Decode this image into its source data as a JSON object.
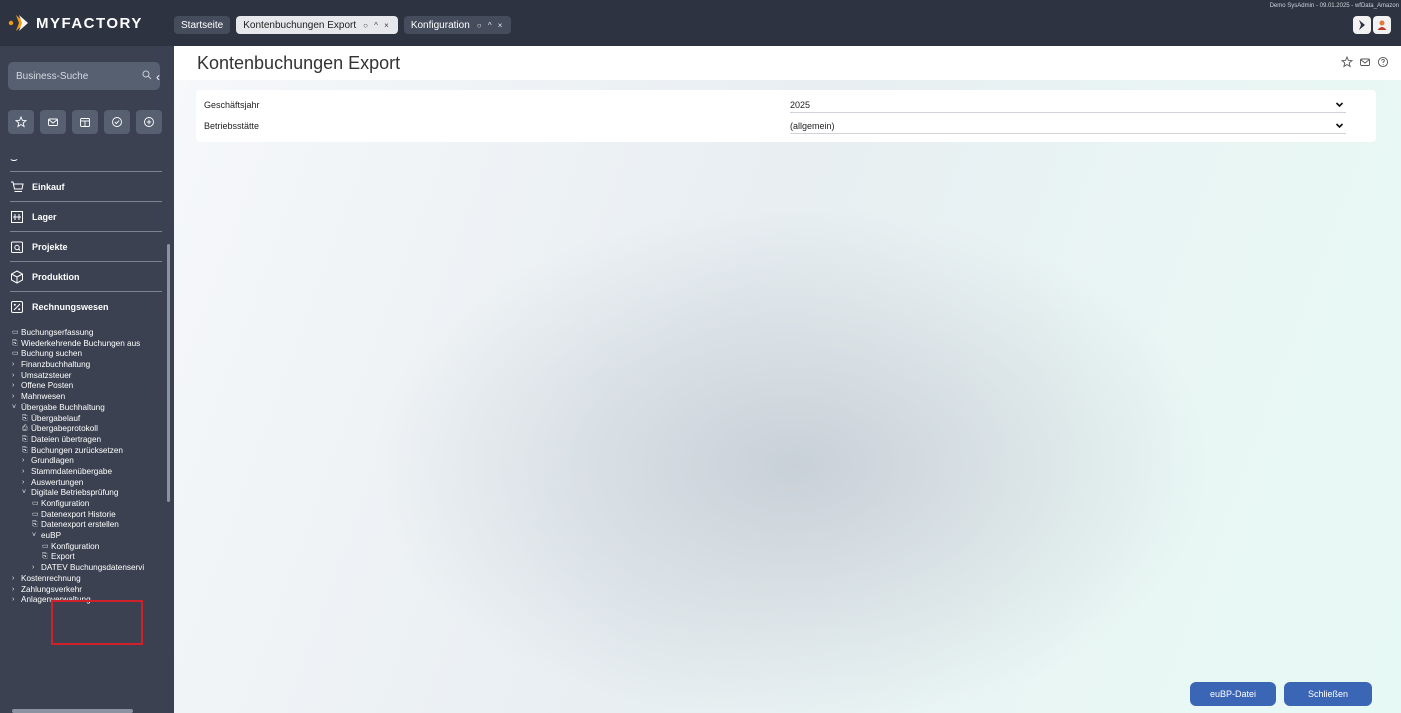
{
  "app": {
    "brand": "MYFACTORY",
    "user_info": "Demo SysAdmin - 09.01.2025 - wfData_Amazon"
  },
  "tabs": [
    {
      "label": "Startseite",
      "active": false,
      "controls": ""
    },
    {
      "label": "Kontenbuchungen Export",
      "active": true,
      "controls": "○ ^ ×"
    },
    {
      "label": "Konfiguration",
      "active": false,
      "controls": "○ ^ ×"
    }
  ],
  "sidebar": {
    "search_placeholder": "Business-Suche",
    "quick_icons": [
      "star-icon",
      "mail-icon",
      "calendar-icon",
      "check-circle-icon",
      "plus-circle-icon"
    ],
    "modules": [
      "Einkauf",
      "Lager",
      "Projekte",
      "Produktion",
      "Rechnungswesen"
    ],
    "tree": [
      {
        "depth": 0,
        "glyph": "▭",
        "label": "Buchungserfassung"
      },
      {
        "depth": 0,
        "glyph": "⎘",
        "label": "Wiederkehrende Buchungen aus"
      },
      {
        "depth": 0,
        "glyph": "▭",
        "label": "Buchung suchen"
      },
      {
        "depth": 0,
        "glyph": "›",
        "label": "Finanzbuchhaltung"
      },
      {
        "depth": 0,
        "glyph": "›",
        "label": "Umsatzsteuer"
      },
      {
        "depth": 0,
        "glyph": "›",
        "label": "Offene Posten"
      },
      {
        "depth": 0,
        "glyph": "›",
        "label": "Mahnwesen"
      },
      {
        "depth": 0,
        "glyph": "˅",
        "label": "Übergabe Buchhaltung"
      },
      {
        "depth": 1,
        "glyph": "⎘",
        "label": "Übergabelauf"
      },
      {
        "depth": 1,
        "glyph": "⎙",
        "label": "Übergabeprotokoll"
      },
      {
        "depth": 1,
        "glyph": "⎘",
        "label": "Dateien übertragen"
      },
      {
        "depth": 1,
        "glyph": "⎘",
        "label": "Buchungen zurücksetzen"
      },
      {
        "depth": 1,
        "glyph": "›",
        "label": "Grundlagen"
      },
      {
        "depth": 1,
        "glyph": "›",
        "label": "Stammdatenübergabe"
      },
      {
        "depth": 1,
        "glyph": "›",
        "label": "Auswertungen"
      },
      {
        "depth": 1,
        "glyph": "˅",
        "label": "Digitale Betriebsprüfung"
      },
      {
        "depth": 2,
        "glyph": "▭",
        "label": "Konfiguration"
      },
      {
        "depth": 2,
        "glyph": "▭",
        "label": "Datenexport Historie"
      },
      {
        "depth": 2,
        "glyph": "⎘",
        "label": "Datenexport erstellen"
      },
      {
        "depth": 2,
        "glyph": "˅",
        "label": "euBP"
      },
      {
        "depth": 3,
        "glyph": "▭",
        "label": "Konfiguration"
      },
      {
        "depth": 3,
        "glyph": "⎘",
        "label": "Export"
      },
      {
        "depth": 2,
        "glyph": "›",
        "label": "DATEV Buchungsdatenservi"
      },
      {
        "depth": 0,
        "glyph": "›",
        "label": "Kostenrechnung"
      },
      {
        "depth": 0,
        "glyph": "›",
        "label": "Zahlungsverkehr"
      },
      {
        "depth": 0,
        "glyph": "›",
        "label": "Anlagenverwaltung"
      }
    ]
  },
  "main": {
    "title": "Kontenbuchungen Export",
    "fields": [
      {
        "label": "Geschäftsjahr",
        "value": "2025"
      },
      {
        "label": "Betriebsstätte",
        "value": "(allgemein)"
      }
    ],
    "buttons": {
      "eubp": "euBP-Datei",
      "close": "Schließen"
    }
  },
  "colors": {
    "topbar": "#2d3340",
    "sidebar": "#3b4150",
    "accent_orange": "#f39c12",
    "button_blue": "#3b65b5",
    "highlight_red": "#d0202a"
  }
}
